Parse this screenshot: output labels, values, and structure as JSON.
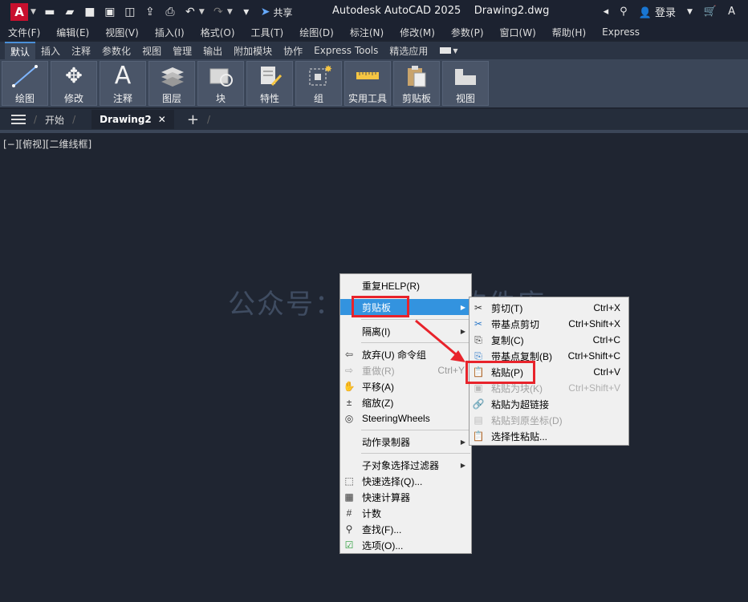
{
  "titlebar": {
    "logo": "A",
    "share_label": "共享",
    "title": "Autodesk AutoCAD 2025    Drawing2.dwg",
    "login_label": "登录"
  },
  "menubar": [
    "文件(F)",
    "编辑(E)",
    "视图(V)",
    "插入(I)",
    "格式(O)",
    "工具(T)",
    "绘图(D)",
    "标注(N)",
    "修改(M)",
    "参数(P)",
    "窗口(W)",
    "帮助(H)",
    "Express"
  ],
  "ribbon_tabs": [
    "默认",
    "插入",
    "注释",
    "参数化",
    "视图",
    "管理",
    "输出",
    "附加模块",
    "协作",
    "Express Tools",
    "精选应用"
  ],
  "ribbon_panels": [
    "绘图",
    "修改",
    "注释",
    "图层",
    "块",
    "特性",
    "组",
    "实用工具",
    "剪贴板",
    "视图"
  ],
  "doc_tabs": {
    "start": "开始",
    "current": "Drawing2"
  },
  "viewport_label": "[−][俯视][二维线框]",
  "watermark": "公众号：软件管家软件库",
  "context_menu": [
    {
      "label": "重复HELP(R)",
      "icon": "none"
    },
    {
      "label": "剪贴板",
      "icon": "none",
      "submenu": true,
      "highlighted": true
    },
    {
      "label": "隔离(I)",
      "icon": "none",
      "submenu": true
    },
    {
      "label": "放弃(U) 命令组",
      "icon": "undo-icon"
    },
    {
      "label": "重做(R)",
      "shortcut": "Ctrl+Y",
      "icon": "redo-icon",
      "disabled": true
    },
    {
      "label": "平移(A)",
      "icon": "pan-icon"
    },
    {
      "label": "缩放(Z)",
      "icon": "zoom-icon"
    },
    {
      "label": "SteeringWheels",
      "icon": "steering-wheel-icon"
    },
    {
      "label": "动作录制器",
      "icon": "none",
      "submenu": true
    },
    {
      "label": "子对象选择过滤器",
      "icon": "none",
      "submenu": true
    },
    {
      "label": "快速选择(Q)...",
      "icon": "quick-select-icon"
    },
    {
      "label": "快速计算器",
      "icon": "calculator-icon"
    },
    {
      "label": "计数",
      "icon": "count-icon"
    },
    {
      "label": "查找(F)...",
      "icon": "find-icon"
    },
    {
      "label": "选项(O)...",
      "icon": "options-icon"
    }
  ],
  "clipboard_submenu": [
    {
      "label": "剪切(T)",
      "shortcut": "Ctrl+X"
    },
    {
      "label": "带基点剪切",
      "shortcut": "Ctrl+Shift+X"
    },
    {
      "label": "复制(C)",
      "shortcut": "Ctrl+C"
    },
    {
      "label": "带基点复制(B)",
      "shortcut": "Ctrl+Shift+C"
    },
    {
      "label": "粘贴(P)",
      "shortcut": "Ctrl+V"
    },
    {
      "label": "粘贴为块(K)",
      "shortcut": "Ctrl+Shift+V",
      "disabled": true
    },
    {
      "label": "粘贴为超链接",
      "shortcut": ""
    },
    {
      "label": "粘贴到原坐标(D)",
      "shortcut": "",
      "disabled": true
    },
    {
      "label": "选择性粘贴...",
      "shortcut": ""
    }
  ],
  "colors": {
    "canvas": "#1f2531",
    "highlight": "#3393df",
    "annotation_red": "#e8232b"
  }
}
